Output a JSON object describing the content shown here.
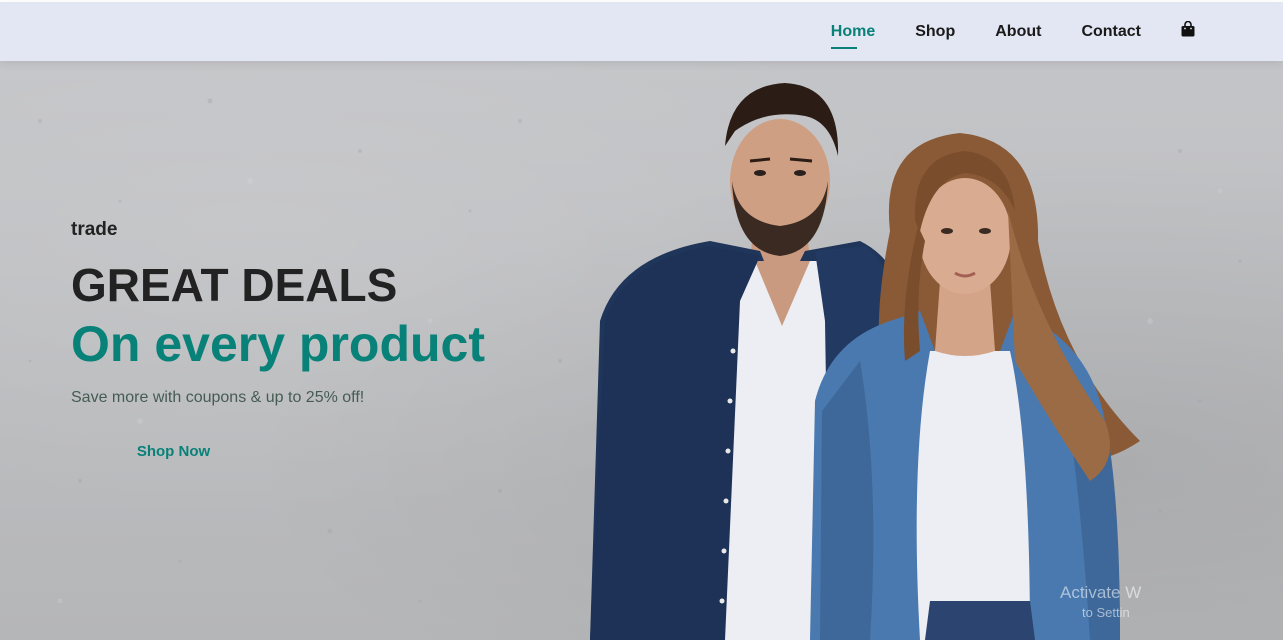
{
  "nav": {
    "items": [
      {
        "label": "Home",
        "active": true
      },
      {
        "label": "Shop",
        "active": false
      },
      {
        "label": "About",
        "active": false
      },
      {
        "label": "Contact",
        "active": false
      }
    ],
    "cart_icon": "shopping-bag-icon"
  },
  "hero": {
    "tagline": "trade",
    "heading": "GREAT DEALS",
    "subheading": "On every product",
    "description": "Save more with coupons & up to 25% off!",
    "cta_label": "Shop Now",
    "image": "couple-in-denim-jackets-photo"
  },
  "watermark": {
    "line1": "Activate W",
    "line2": "to Settin"
  },
  "colors": {
    "accent": "#088178",
    "nav_bg": "#e3e6f3",
    "text_dark": "#222222",
    "hero_bg": "#bdbec0"
  }
}
